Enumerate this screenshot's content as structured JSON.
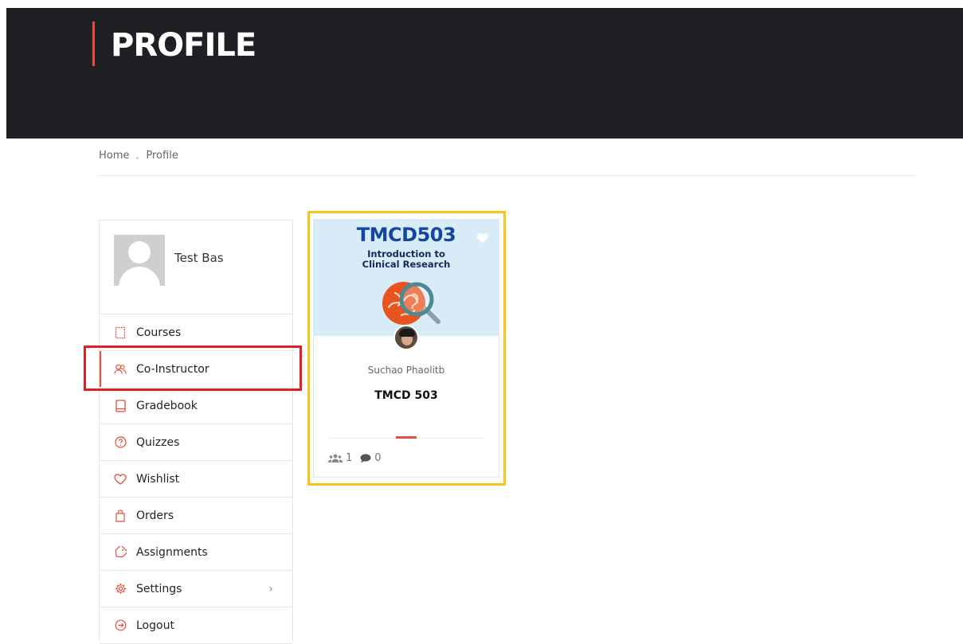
{
  "header": {
    "title": "PROFILE"
  },
  "breadcrumb": {
    "home": "Home",
    "current": "Profile"
  },
  "user": {
    "name": "Test Bas"
  },
  "menu": {
    "courses": "Courses",
    "co_instructor": "Co-Instructor",
    "gradebook": "Gradebook",
    "quizzes": "Quizzes",
    "wishlist": "Wishlist",
    "orders": "Orders",
    "assignments": "Assignments",
    "settings": "Settings",
    "logout": "Logout"
  },
  "course_card": {
    "thumbnail_code": "TMCD503",
    "thumbnail_subtitle_1": "Introduction to",
    "thumbnail_subtitle_2": "Clinical Research",
    "instructor": "Suchao Phaolitb",
    "title": "TMCD 503",
    "students": "1",
    "comments": "0"
  },
  "colors": {
    "accent": "#e74c3c",
    "header_bg": "#1f2024",
    "highlight_card": "#f5c518",
    "highlight_menu": "#e31e24"
  }
}
